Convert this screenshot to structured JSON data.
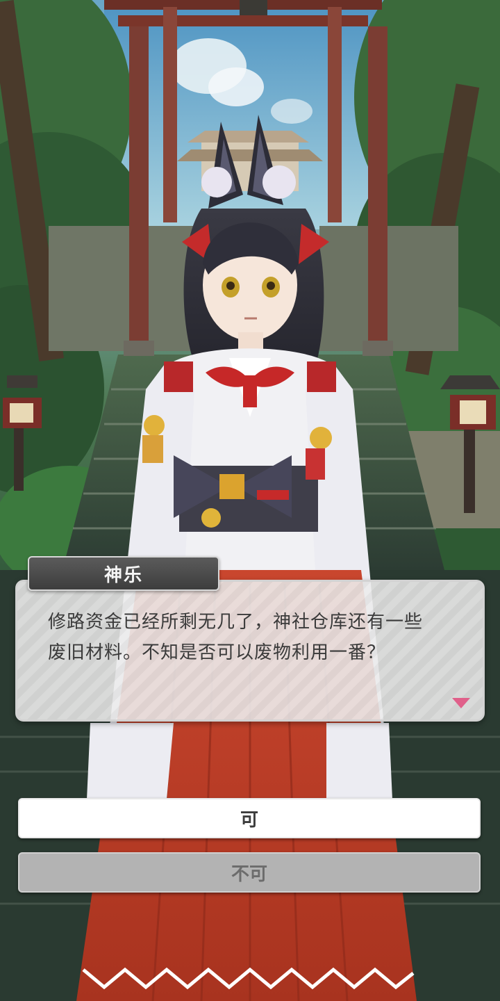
{
  "dialogue": {
    "speaker": "神乐",
    "text": "修路资金已经所剩无几了，神社仓库还有一些\n废旧材料。不知是否可以废物利用一番？",
    "advance_icon": "triangle-down-icon",
    "accent_color": "#e0608a"
  },
  "choices": [
    {
      "label": "可"
    },
    {
      "label": "不可"
    }
  ]
}
